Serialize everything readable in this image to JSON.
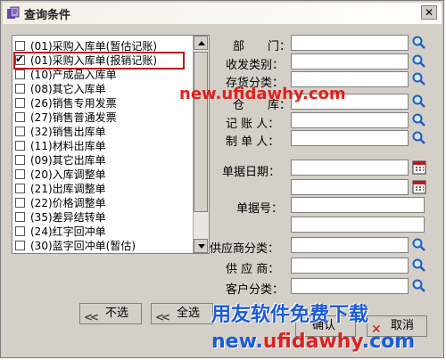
{
  "window": {
    "title": "查询条件",
    "close_glyph": "✕"
  },
  "list": {
    "items": [
      {
        "label": "(01)采购入库单(暂估记账)",
        "checked": false
      },
      {
        "label": "(01)采购入库单(报销记账)",
        "checked": true
      },
      {
        "label": "(10)产成品入库单",
        "checked": false
      },
      {
        "label": "(08)其它入库单",
        "checked": false
      },
      {
        "label": "(26)销售专用发票",
        "checked": false
      },
      {
        "label": "(27)销售普通发票",
        "checked": false
      },
      {
        "label": "(32)销售出库单",
        "checked": false
      },
      {
        "label": "(11)材料出库单",
        "checked": false
      },
      {
        "label": "(09)其它出库单",
        "checked": false
      },
      {
        "label": "(20)入库调整单",
        "checked": false
      },
      {
        "label": "(21)出库调整单",
        "checked": false
      },
      {
        "label": "(22)价格调整单",
        "checked": false
      },
      {
        "label": "(35)差异结转单",
        "checked": false
      },
      {
        "label": "(24)红字回冲单",
        "checked": false
      },
      {
        "label": "(30)蓝字回冲单(暂估)",
        "checked": false
      }
    ]
  },
  "form": {
    "department": "部　　门：",
    "send_type": "收发类别：",
    "inventory_class": "存货分类：",
    "warehouse": "仓　　库：",
    "bookkeeper": "记 账 人：",
    "maker": "制 单 人：",
    "doc_date": "单据日期：",
    "doc_no": "单据号：",
    "supplier_class": "供应商分类：",
    "supplier": "供 应 商：",
    "customer_class": "客户分类："
  },
  "buttons": {
    "deselect": "不选",
    "select_all": "全选",
    "confirm": "确认",
    "cancel": "取消"
  },
  "watermark": {
    "url": "new.ufidawhy.com",
    "slogan": "用友软件免费下载",
    "url2_prefix": "new.",
    "url2_mid": "ufidawhy",
    "url2_suffix": ".com"
  },
  "colors": {
    "highlight": "#c0161b",
    "watermark_blue": "#1a5bd8",
    "watermark_red": "#e02020"
  }
}
